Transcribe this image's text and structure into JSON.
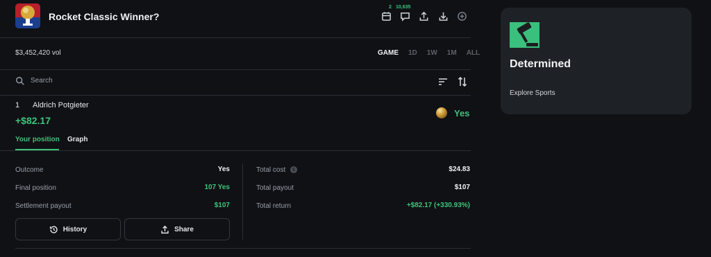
{
  "market": {
    "title": "Rocket Classic Winner?",
    "volume": "$3,452,420 vol"
  },
  "header_icons": {
    "calendar_count": "2",
    "comments_count": "10,635"
  },
  "time_ranges": [
    "GAME",
    "1D",
    "1W",
    "1M",
    "ALL"
  ],
  "search": {
    "placeholder": "Search"
  },
  "row": {
    "rank": "1",
    "name": "Aldrich Potgieter",
    "profit": "+$82.17",
    "outcome_label": "Yes"
  },
  "tabs": {
    "position": "Your position",
    "graph": "Graph"
  },
  "position": {
    "outcome_label": "Outcome",
    "outcome_value": "Yes",
    "final_label": "Final position",
    "final_value": "107 Yes",
    "settlement_label": "Settlement payout",
    "settlement_value": "$107",
    "cost_label": "Total cost",
    "cost_value": "$24.83",
    "payout_label": "Total payout",
    "payout_value": "$107",
    "return_label": "Total return",
    "return_value": "+$82.17 (+330.93%)"
  },
  "buttons": {
    "history": "History",
    "share": "Share"
  },
  "side": {
    "title": "Determined",
    "link": "Explore Sports"
  },
  "colors": {
    "accent_green": "#3fc37a",
    "background": "#0f1115",
    "card": "#1e2126"
  }
}
